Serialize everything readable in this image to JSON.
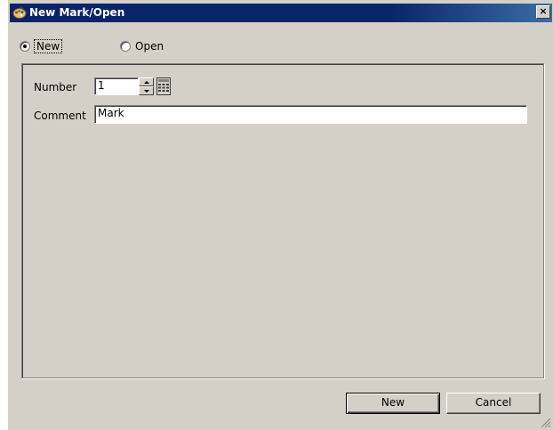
{
  "window": {
    "title": "New Mark/Open"
  },
  "mode": {
    "options": [
      {
        "label": "New",
        "checked": true
      },
      {
        "label": "Open",
        "checked": false
      }
    ]
  },
  "form": {
    "number_label": "Number",
    "number_value": "1",
    "comment_label": "Comment",
    "comment_value": "Mark"
  },
  "buttons": {
    "new_label": "New",
    "cancel_label": "Cancel"
  },
  "colors": {
    "titlebar": "#0a246a",
    "face": "#d4d0c8"
  },
  "icons": {
    "app": "paint-palette-icon",
    "close": "close-icon",
    "keypad": "keypad-icon",
    "grip": "resize-grip-icon"
  }
}
